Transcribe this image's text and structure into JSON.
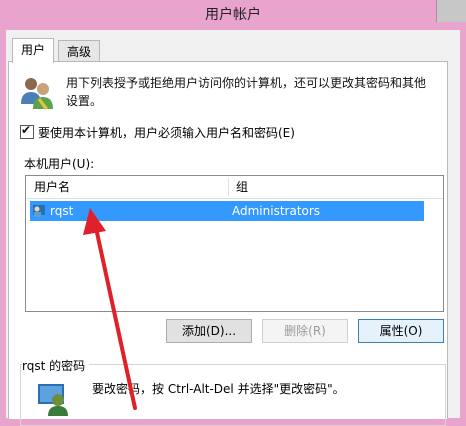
{
  "window": {
    "title": "用户帐户"
  },
  "tabs": [
    {
      "label": "用户",
      "active": true
    },
    {
      "label": "高级",
      "active": false
    }
  ],
  "intro": {
    "text": "用下列表授予或拒绝用户访问你的计算机，还可以更改其密码和其他设置。"
  },
  "checkbox": {
    "label": "要使用本计算机，用户必须输入用户名和密码(E)",
    "checked": true
  },
  "local_users": {
    "label": "本机用户(U):",
    "columns": [
      "用户名",
      "组"
    ],
    "rows": [
      {
        "name": "rqst",
        "group": "Administrators",
        "selected": true
      }
    ]
  },
  "buttons": {
    "add": "添加(D)...",
    "delete": "删除(R)",
    "properties": "属性(O)"
  },
  "password": {
    "group_label": "rqst 的密码",
    "text": "要改密码，按 Ctrl-Alt-Del 并选择\"更改密码\"。"
  },
  "colors": {
    "accent": "#3399ff",
    "frame": "#e8a4cd",
    "annotation_arrow": "#e0202a"
  },
  "icons": [
    "users-icon",
    "user-row-icon",
    "password-user-icon",
    "close-icon",
    "checkmark-icon"
  ]
}
